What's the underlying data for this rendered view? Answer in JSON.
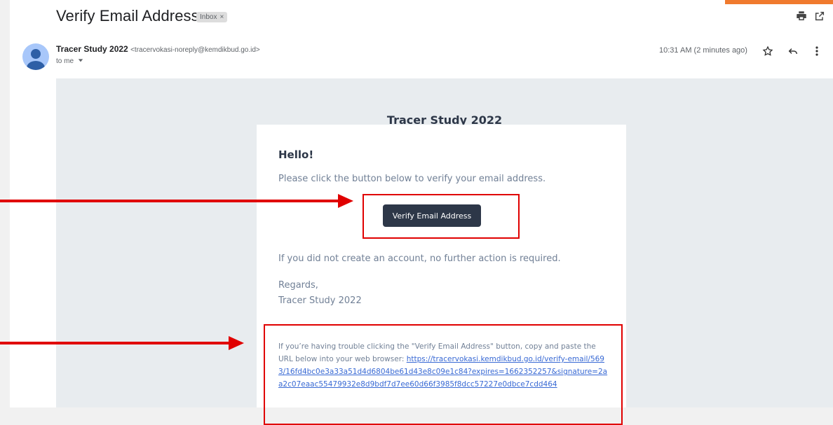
{
  "email": {
    "subject": "Verify Email Address",
    "label": "Inbox",
    "label_close": "×",
    "sender_name": "Tracer Study 2022",
    "sender_address": "<tracervokasi-noreply@kemdikbud.go.id>",
    "recipient": "to me",
    "time": "10:31 AM (2 minutes ago)"
  },
  "message": {
    "title": "Tracer Study 2022",
    "greeting": "Hello!",
    "intro": "Please click the button below to verify your email address.",
    "button_label": "Verify Email Address",
    "no_action": "If you did not create an account, no further action is required.",
    "regards": "Regards,",
    "signature": "Tracer Study 2022",
    "trouble_text": "If you’re having trouble clicking the \"Verify Email Address\" button, copy and paste the URL below into your web browser: ",
    "verify_url": "https://tracervokasi.kemdikbud.go.id/verify-email/5693/16fd4bc0e3a33a51d4d6804be61d43e8c09e1c84?expires=1662352257&signature=2aa2c07eaac55479932e8d9bdf7d7ee60d66f3985f8dcc57227e0dbce7cdd464"
  },
  "icons": {
    "print": "print-icon",
    "open_new": "open-in-new-icon",
    "star": "star-icon",
    "reply": "reply-icon",
    "more": "more-vert-icon",
    "avatar": "avatar-icon",
    "dropdown": "chevron-down-icon"
  },
  "colors": {
    "annotation": "#e00000",
    "button_bg": "#2d3748",
    "link": "#3869d4",
    "accent_strip": "#f07a2e"
  }
}
